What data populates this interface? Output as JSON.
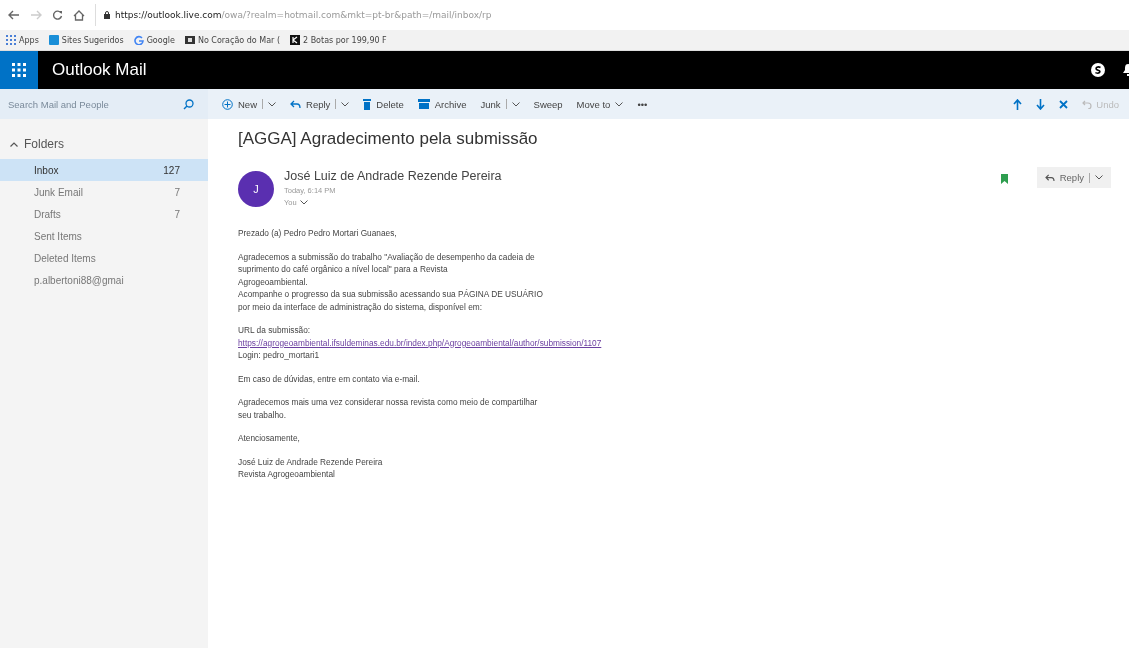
{
  "browser": {
    "url_host": "https://outlook.live.com",
    "url_rest": "/owa/?realm=hotmail.com&mkt=pt-br&path=/mail/inbox/rp",
    "bookmarks": [
      {
        "label": "Apps"
      },
      {
        "label": "Sites Sugeridos"
      },
      {
        "label": "Google"
      },
      {
        "label": "No Coração do Mar ("
      },
      {
        "label": "2 Botas por 199,90 F"
      }
    ]
  },
  "header": {
    "app_title": "Outlook Mail"
  },
  "search": {
    "placeholder": "Search Mail and People"
  },
  "folders": {
    "title": "Folders",
    "expanded": true,
    "items": [
      {
        "label": "Inbox",
        "count": "127",
        "selected": true
      },
      {
        "label": "Junk Email",
        "count": "7",
        "selected": false
      },
      {
        "label": "Drafts",
        "count": "7",
        "selected": false
      },
      {
        "label": "Sent Items",
        "selected": false
      },
      {
        "label": "Deleted Items",
        "selected": false
      },
      {
        "label": "p.albertoni88@gmai",
        "selected": false
      }
    ]
  },
  "toolbar": {
    "actions": [
      {
        "label": "New",
        "dropdown": true
      },
      {
        "label": "Reply",
        "dropdown": true
      },
      {
        "label": "Delete",
        "dropdown": false
      },
      {
        "label": "Archive",
        "dropdown": false
      },
      {
        "label": "Junk",
        "dropdown": true
      },
      {
        "label": "Sweep",
        "dropdown": false
      },
      {
        "label": "Move to",
        "dropdown": true
      },
      {
        "label": "•••",
        "dropdown": false
      }
    ],
    "undo": {
      "label": "Undo",
      "disabled": true
    }
  },
  "message": {
    "subject": "[AGGA] Agradecimento pela submissão",
    "avatar": "J",
    "sender": "José Luiz de Andrade Rezende Pereira",
    "time": "Today, 6:14 PM",
    "to": "You",
    "reply": {
      "label": "Reply"
    },
    "paragraphs": [
      {
        "lines": [
          {
            "kind": "text",
            "text": "Prezado (a) Pedro Pedro Mortari Guanaes,"
          }
        ]
      },
      {
        "lines": [
          {
            "kind": "text",
            "text": "Agradecemos a submissão do trabalho \"Avaliação de desempenho da cadeia de"
          },
          {
            "kind": "text",
            "text": "suprimento do café orgânico a nível local\" para a Revista"
          },
          {
            "kind": "text",
            "text": "Agrogeoambiental."
          },
          {
            "kind": "text",
            "text": "Acompanhe o progresso da sua submissão acessando sua PÁGINA DE USUÁRIO"
          },
          {
            "kind": "text",
            "text": "por meio da interface de administração do sistema, disponível em:"
          }
        ]
      },
      {
        "lines": [
          {
            "kind": "text",
            "text": "URL da submissão:"
          },
          {
            "kind": "link",
            "text": "https://agrogeoambiental.ifsuldeminas.edu.br/index.php/Agrogeoambiental/author/submission/1107"
          },
          {
            "kind": "text",
            "text": "Login: pedro_mortari1"
          }
        ]
      },
      {
        "lines": [
          {
            "kind": "text",
            "text": "Em caso de dúvidas,  entre em contato via e-mail."
          }
        ]
      },
      {
        "lines": [
          {
            "kind": "text",
            "text": "Agradecemos mais uma vez considerar nossa revista como meio de compartilhar"
          },
          {
            "kind": "text",
            "text": "seu trabalho."
          }
        ]
      },
      {
        "lines": [
          {
            "kind": "text",
            "text": "Atenciosamente,"
          }
        ]
      },
      {
        "lines": [
          {
            "kind": "text",
            "text": "José Luiz de Andrade Rezende Pereira"
          },
          {
            "kind": "text",
            "text": "Revista Agrogeoambiental"
          }
        ]
      }
    ]
  }
}
